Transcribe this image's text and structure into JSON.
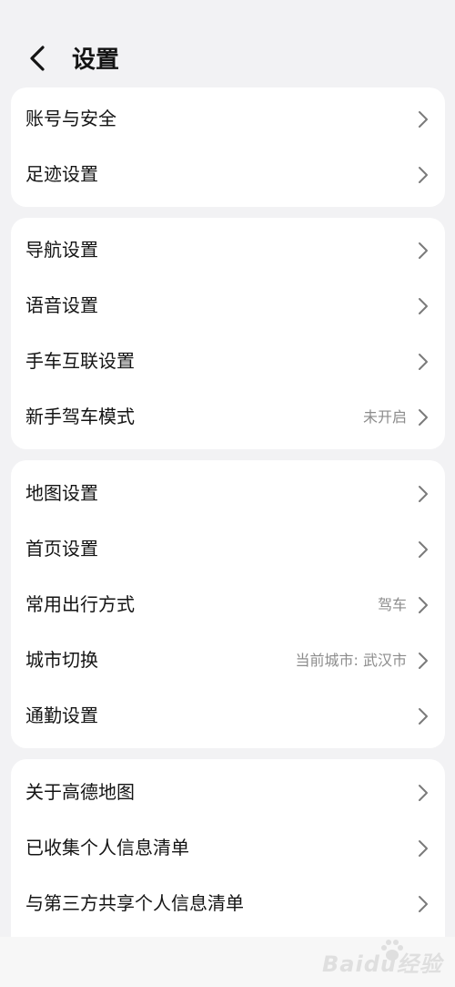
{
  "header": {
    "back_icon": "chevron-left-icon",
    "title": "设置"
  },
  "sections": [
    {
      "items": [
        {
          "label": "账号与安全",
          "value": ""
        },
        {
          "label": "足迹设置",
          "value": ""
        }
      ]
    },
    {
      "items": [
        {
          "label": "导航设置",
          "value": ""
        },
        {
          "label": "语音设置",
          "value": ""
        },
        {
          "label": "手车互联设置",
          "value": ""
        },
        {
          "label": "新手驾车模式",
          "value": "未开启"
        }
      ]
    },
    {
      "items": [
        {
          "label": "地图设置",
          "value": ""
        },
        {
          "label": "首页设置",
          "value": ""
        },
        {
          "label": "常用出行方式",
          "value": "驾车"
        },
        {
          "label": "城市切换",
          "value": "当前城市: 武汉市"
        },
        {
          "label": "通勤设置",
          "value": ""
        }
      ]
    },
    {
      "items": [
        {
          "label": "关于高德地图",
          "value": ""
        },
        {
          "label": "已收集个人信息清单",
          "value": ""
        },
        {
          "label": "与第三方共享个人信息清单",
          "value": ""
        }
      ]
    }
  ],
  "row_chevron_icon": "chevron-right-icon",
  "watermark": {
    "text": "Baidu经验"
  },
  "colors": {
    "background": "#f2f2f4",
    "card": "#ffffff",
    "text": "#141414",
    "secondary_text": "#8c8c8c",
    "chevron": "#7a7a7a"
  }
}
